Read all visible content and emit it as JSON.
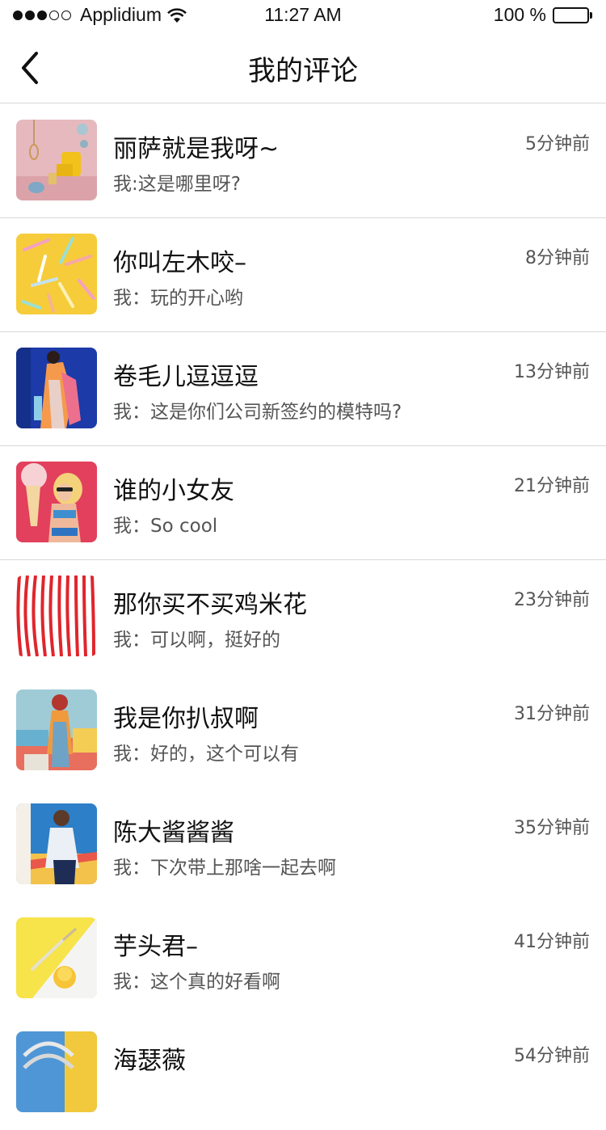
{
  "status_bar": {
    "carrier": "Applidium",
    "time": "11:27 AM",
    "battery": "100 %",
    "signal_bars_filled": 3,
    "signal_bars_total": 5
  },
  "nav": {
    "title": "我的评论",
    "back_icon": "chevron-left-icon"
  },
  "comments": [
    {
      "name": "丽萨就是我呀~",
      "comment": "我:这是哪里呀?",
      "time": "5分钟前"
    },
    {
      "name": "你叫左木咬–",
      "comment": "我：玩的开心哟",
      "time": "8分钟前"
    },
    {
      "name": "卷毛儿逗逗逗",
      "comment": "我：这是你们公司新签约的模特吗?",
      "time": "13分钟前"
    },
    {
      "name": "谁的小女友",
      "comment": "我：So cool",
      "time": "21分钟前"
    },
    {
      "name": "那你买不买鸡米花",
      "comment": "我：可以啊，挺好的",
      "time": "23分钟前"
    },
    {
      "name": "我是你扒叔啊",
      "comment": "我：好的，这个可以有",
      "time": "31分钟前"
    },
    {
      "name": "陈大酱酱酱",
      "comment": "我：下次带上那啥一起去啊",
      "time": "35分钟前"
    },
    {
      "name": "芋头君–",
      "comment": "我：这个真的好看啊",
      "time": "41分钟前"
    },
    {
      "name": "海瑟薇",
      "comment": "",
      "time": "54分钟前"
    }
  ]
}
